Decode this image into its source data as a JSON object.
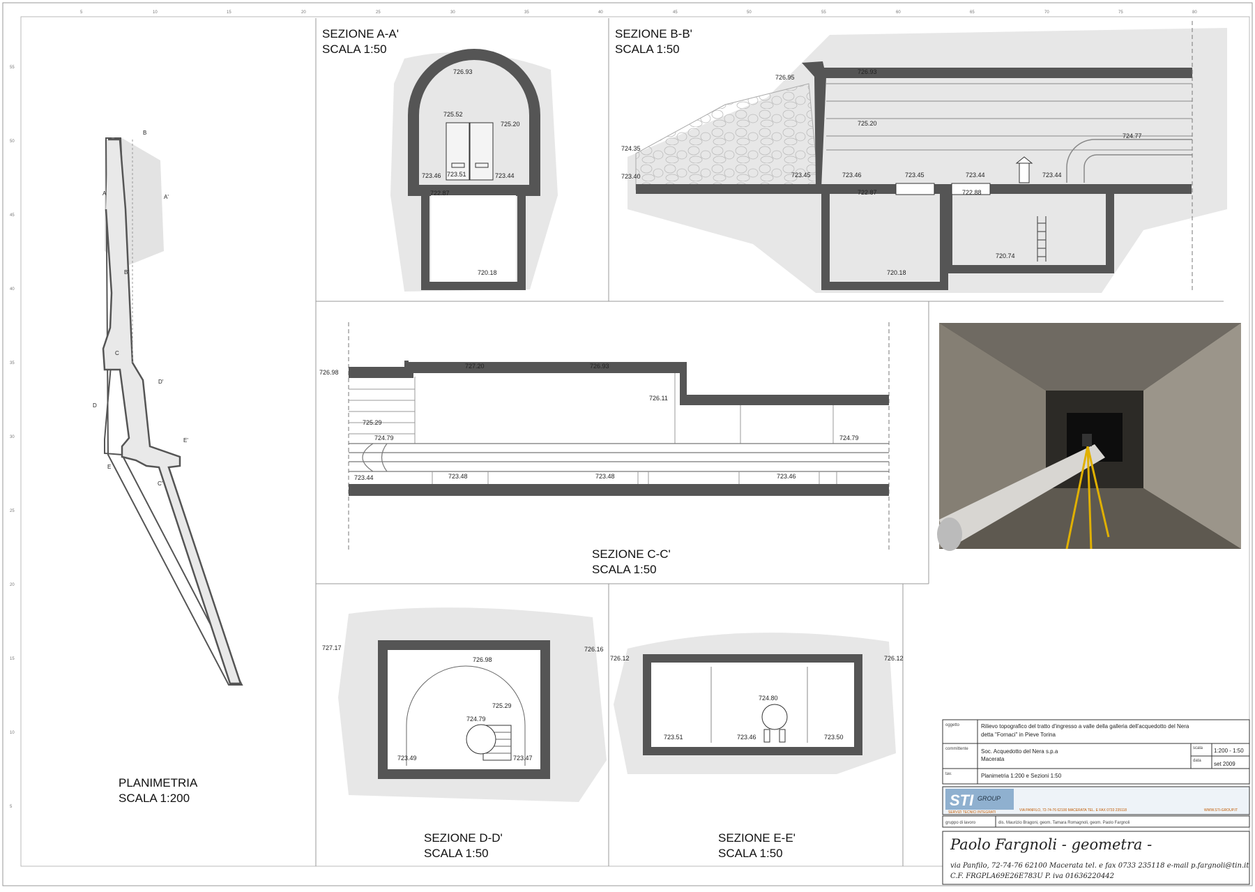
{
  "ruler": {
    "top": [
      "5",
      "10",
      "15",
      "20",
      "25",
      "30",
      "35",
      "40",
      "45",
      "50",
      "55",
      "60",
      "65",
      "70",
      "75",
      "80"
    ],
    "left": [
      "55",
      "50",
      "45",
      "40",
      "35",
      "30",
      "25",
      "20",
      "15",
      "10",
      "5"
    ]
  },
  "sections": {
    "planimetria": {
      "title": "PLANIMETRIA",
      "scale": "SCALA 1:200"
    },
    "aa": {
      "title": "SEZIONE A-A'",
      "scale": "SCALA 1:50"
    },
    "bb": {
      "title": "SEZIONE B-B'",
      "scale": "SCALA 1:50"
    },
    "cc": {
      "title": "SEZIONE C-C'",
      "scale": "SCALA 1:50"
    },
    "dd": {
      "title": "SEZIONE D-D'",
      "scale": "SCALA 1:50"
    },
    "ee": {
      "title": "SEZIONE E-E'",
      "scale": "SCALA 1:50"
    }
  },
  "plan_labels": {
    "b": "B",
    "a": "A",
    "a2": "A'",
    "b2": "B'",
    "c": "C",
    "d": "D",
    "d2": "D'",
    "e": "E",
    "e2": "E'",
    "c2": "C'"
  },
  "elevations": {
    "aa": [
      "726.93",
      "725.52",
      "725.20",
      "723.46",
      "723.51",
      "723.44",
      "722.87",
      "720.18"
    ],
    "bb": [
      "726.95",
      "726.93",
      "725.20",
      "724.77",
      "724.35",
      "723.40",
      "723.45",
      "723.46",
      "723.45",
      "723.44",
      "723.44",
      "722.87",
      "722.88",
      "720.74",
      "720.18"
    ],
    "cc": [
      "726.98",
      "727.20",
      "726.93",
      "726.11",
      "725.29",
      "724.79",
      "724.79",
      "723.44",
      "723.48",
      "723.48",
      "723.46"
    ],
    "dd": [
      "727.17",
      "726.16",
      "726.98",
      "725.29",
      "724.79",
      "723.49",
      "723.47"
    ],
    "ee": [
      "726.12",
      "726.12",
      "724.80",
      "723.51",
      "723.46",
      "723.50"
    ]
  },
  "titleblock": {
    "oggetto_label": "oggetto",
    "oggetto_line1": "Rilievo topografico del tratto d'ingresso a valle della galleria dell'acquedotto del Nera",
    "oggetto_line2": "detta \"Fornaci\" in Pieve Torina",
    "committente_label": "committente",
    "committente_line1": "Soc. Acquedotto del Nera s.p.a",
    "committente_line2": "Macerata",
    "scala_label": "scala",
    "scala_value": "1:200 - 1:50",
    "data_label": "data",
    "data_value": "set 2009",
    "tav_label": "tav.",
    "tav_value": "Planimetria 1:200 e Sezioni 1:50",
    "logo_text": "STI",
    "logo_group": "GROUP",
    "logo_sub": "SERVIZI TECNICI INTEGRATI",
    "logo_address": "VIA PANFILO, 72-74-76   62100 MACERATA TEL. E FAX  0733 235118",
    "logo_web": "WWW.STI-GROUP.IT",
    "gruppo_label": "gruppo di lavoro",
    "gruppo_value": "dis. Maurizio Bragoni, geom. Tamara Romagnoli, geom. Paolo Fargnoli",
    "signature_name": "Paolo Fargnoli   - geometra -",
    "signature_address": "via Panfilo, 72-74-76   62100 Macerata   tel. e fax 0733 235118    e-mail p.fargnoli@tin.it",
    "signature_cf": "C.F. FRGPLA69E26E783U     P. iva 01636220442"
  },
  "colors": {
    "wall": "#555555",
    "soil": "#dcdcdc",
    "line": "#333333"
  }
}
